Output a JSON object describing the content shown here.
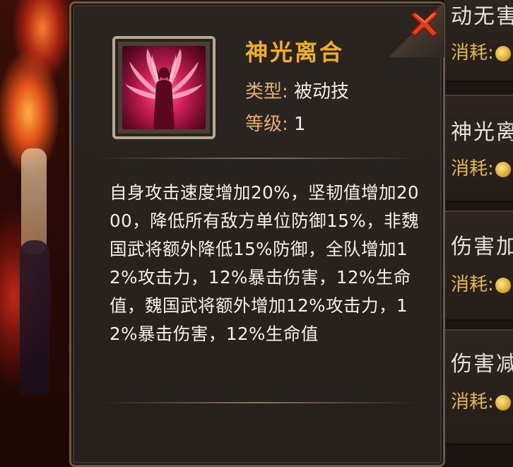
{
  "tooltip": {
    "skill_name": "神光离合",
    "type_label": "类型:",
    "type_value": "被动技",
    "level_label": "等级:",
    "level_value": "1",
    "description": "自身攻击速度增加20%，坚韧值增加2000，降低所有敌方单位防御15%，非魏国武将额外降低15%防御，全队增加12%攻击力，12%暴击伤害，12%生命值，魏国武将额外增加12%攻击力，12%暴击伤害，12%生命值",
    "close_icon": "close-icon",
    "skill_icon": "winged-figure-icon"
  },
  "right_list": {
    "items": [
      {
        "title": "动无害",
        "cost_label": "消耗:"
      },
      {
        "title": "神光离",
        "cost_label": "消耗:"
      },
      {
        "title": "伤害加",
        "cost_label": "消耗:"
      },
      {
        "title": "伤害减",
        "cost_label": "消耗:"
      }
    ]
  },
  "colors": {
    "skill_name": "#f0b020",
    "label": "#e0b070",
    "text": "#f4f0ea",
    "close_x": "#e0401a"
  }
}
